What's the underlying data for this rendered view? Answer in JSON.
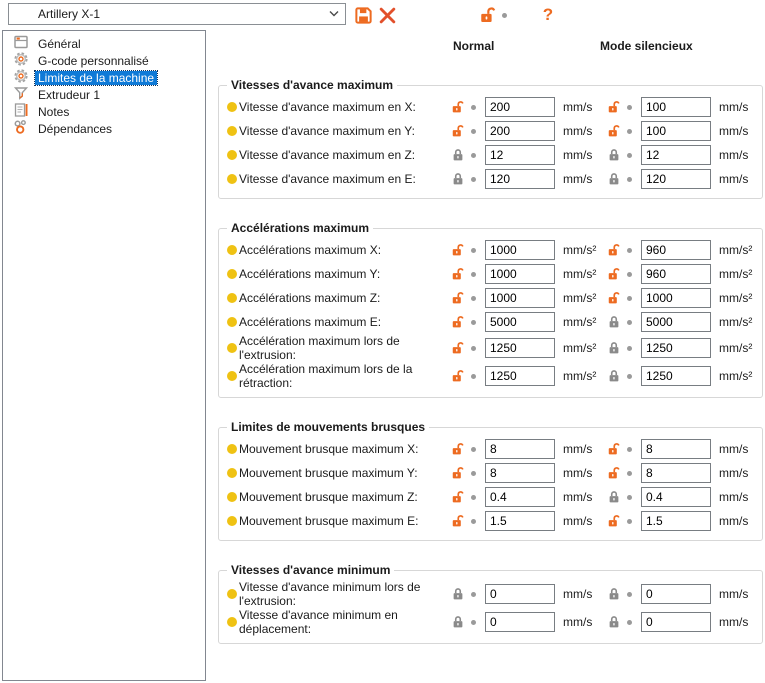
{
  "toolbar": {
    "preset_name": "Artillery X-1",
    "save_tooltip_icon": "save-preset-icon",
    "delete_tooltip_icon": "delete-preset-icon",
    "lock_icon": "unlocked-icon",
    "help_label": "?"
  },
  "colors": {
    "accent_orange": "#ED6B21",
    "delete_red": "#e2502b",
    "bullet_yellow": "#efc213",
    "selection_blue": "#0f7ad7",
    "lock_gray": "#8a8a8a"
  },
  "sidebar": {
    "items": [
      {
        "label": "Général",
        "icon": "general-icon",
        "selected": false
      },
      {
        "label": "G-code personnalisé",
        "icon": "gear-icon",
        "selected": false
      },
      {
        "label": "Limites de la machine",
        "icon": "gear-icon",
        "selected": true
      },
      {
        "label": "Extrudeur 1",
        "icon": "funnel-icon",
        "selected": false
      },
      {
        "label": "Notes",
        "icon": "note-icon",
        "selected": false
      },
      {
        "label": "Dépendances",
        "icon": "dependencies-icon",
        "selected": false
      }
    ]
  },
  "columns": [
    "Normal",
    "Mode silencieux"
  ],
  "groups": [
    {
      "legend": "Vitesses d'avance maximum",
      "rows": [
        {
          "label": "Vitesse d'avance maximum en X:",
          "normal": {
            "lock": "open",
            "value": "200",
            "unit": "mm/s"
          },
          "stealth": {
            "lock": "open",
            "value": "100",
            "unit": "mm/s"
          }
        },
        {
          "label": "Vitesse d'avance maximum en Y:",
          "normal": {
            "lock": "open",
            "value": "200",
            "unit": "mm/s"
          },
          "stealth": {
            "lock": "open",
            "value": "100",
            "unit": "mm/s"
          }
        },
        {
          "label": "Vitesse d'avance maximum en Z:",
          "normal": {
            "lock": "closed",
            "value": "12",
            "unit": "mm/s"
          },
          "stealth": {
            "lock": "closed",
            "value": "12",
            "unit": "mm/s"
          }
        },
        {
          "label": "Vitesse d'avance maximum en E:",
          "normal": {
            "lock": "closed",
            "value": "120",
            "unit": "mm/s"
          },
          "stealth": {
            "lock": "closed",
            "value": "120",
            "unit": "mm/s"
          }
        }
      ]
    },
    {
      "legend": "Accélérations maximum",
      "rows": [
        {
          "label": "Accélérations maximum X:",
          "normal": {
            "lock": "open",
            "value": "1000",
            "unit": "mm/s²"
          },
          "stealth": {
            "lock": "open",
            "value": "960",
            "unit": "mm/s²"
          }
        },
        {
          "label": "Accélérations maximum Y:",
          "normal": {
            "lock": "open",
            "value": "1000",
            "unit": "mm/s²"
          },
          "stealth": {
            "lock": "open",
            "value": "960",
            "unit": "mm/s²"
          }
        },
        {
          "label": "Accélérations maximum Z:",
          "normal": {
            "lock": "open",
            "value": "1000",
            "unit": "mm/s²"
          },
          "stealth": {
            "lock": "open",
            "value": "1000",
            "unit": "mm/s²"
          }
        },
        {
          "label": "Accélérations maximum E:",
          "normal": {
            "lock": "open",
            "value": "5000",
            "unit": "mm/s²"
          },
          "stealth": {
            "lock": "closed",
            "value": "5000",
            "unit": "mm/s²"
          }
        },
        {
          "label": "Accélération maximum lors de l'extrusion:",
          "normal": {
            "lock": "open",
            "value": "1250",
            "unit": "mm/s²"
          },
          "stealth": {
            "lock": "closed",
            "value": "1250",
            "unit": "mm/s²"
          }
        },
        {
          "label": "Accélération maximum lors de la rétraction:",
          "normal": {
            "lock": "open",
            "value": "1250",
            "unit": "mm/s²"
          },
          "stealth": {
            "lock": "closed",
            "value": "1250",
            "unit": "mm/s²"
          }
        }
      ]
    },
    {
      "legend": "Limites de mouvements brusques",
      "rows": [
        {
          "label": "Mouvement brusque maximum X:",
          "normal": {
            "lock": "open",
            "value": "8",
            "unit": "mm/s"
          },
          "stealth": {
            "lock": "open",
            "value": "8",
            "unit": "mm/s"
          }
        },
        {
          "label": "Mouvement brusque maximum Y:",
          "normal": {
            "lock": "open",
            "value": "8",
            "unit": "mm/s"
          },
          "stealth": {
            "lock": "open",
            "value": "8",
            "unit": "mm/s"
          }
        },
        {
          "label": "Mouvement brusque maximum Z:",
          "normal": {
            "lock": "open",
            "value": "0.4",
            "unit": "mm/s"
          },
          "stealth": {
            "lock": "closed",
            "value": "0.4",
            "unit": "mm/s"
          }
        },
        {
          "label": "Mouvement brusque maximum E:",
          "normal": {
            "lock": "open",
            "value": "1.5",
            "unit": "mm/s"
          },
          "stealth": {
            "lock": "open",
            "value": "1.5",
            "unit": "mm/s"
          }
        }
      ]
    },
    {
      "legend": "Vitesses d'avance minimum",
      "rows": [
        {
          "label": "Vitesse d'avance minimum lors de l'extrusion:",
          "normal": {
            "lock": "closed",
            "value": "0",
            "unit": "mm/s"
          },
          "stealth": {
            "lock": "closed",
            "value": "0",
            "unit": "mm/s"
          }
        },
        {
          "label": "Vitesse d'avance minimum en déplacement:",
          "normal": {
            "lock": "closed",
            "value": "0",
            "unit": "mm/s"
          },
          "stealth": {
            "lock": "closed",
            "value": "0",
            "unit": "mm/s"
          }
        }
      ]
    }
  ]
}
